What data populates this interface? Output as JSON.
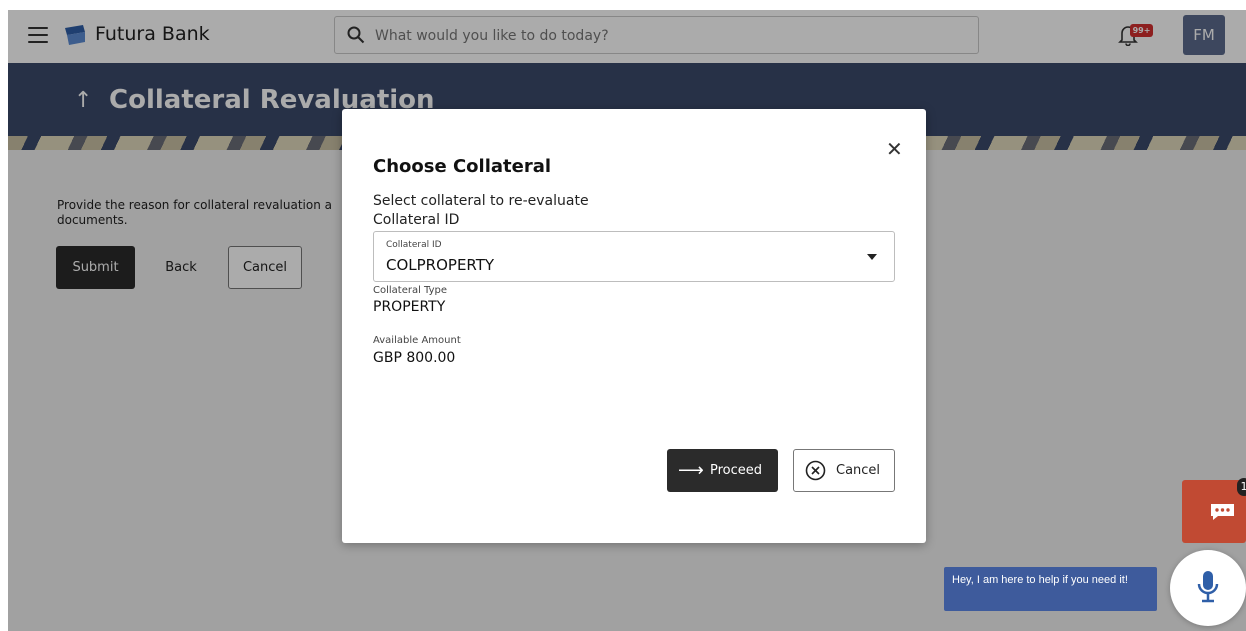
{
  "app": {
    "brand": "Futura Bank",
    "search_placeholder": "What would you like to do today?",
    "notification_badge": "99+",
    "avatar_initials": "FM"
  },
  "page": {
    "title": "Collateral Revaluation",
    "description": "Provide the reason for collateral revaluation a documents.",
    "buttons": {
      "submit": "Submit",
      "back": "Back",
      "cancel": "Cancel"
    }
  },
  "modal": {
    "title": "Choose Collateral",
    "subtitle": "Select collateral to re-evaluate",
    "field_label": "Collateral ID",
    "select": {
      "label": "Collateral ID",
      "value": "COLPROPERTY"
    },
    "collateral_type": {
      "label": "Collateral Type",
      "value": "PROPERTY"
    },
    "available_amount": {
      "label": "Available Amount",
      "value": "GBP 800.00"
    },
    "proceed_label": "Proceed",
    "cancel_label": "Cancel"
  },
  "chat": {
    "badge": "1",
    "assistant_text": "Hey, I am here to help if you need it!"
  },
  "colors": {
    "banner": "#3b4a6b",
    "primary_button": "#2b2b2b",
    "chat": "#c14a33",
    "assistant_bubble": "#3e5b9c",
    "badge": "#d32f2f"
  },
  "icons": [
    "hamburger-icon",
    "bank-logo-icon",
    "search-icon",
    "bell-icon",
    "up-arrow-icon",
    "close-icon",
    "chevron-down-icon",
    "arrow-right-icon",
    "cancel-circle-icon",
    "chat-icon",
    "microphone-icon"
  ]
}
